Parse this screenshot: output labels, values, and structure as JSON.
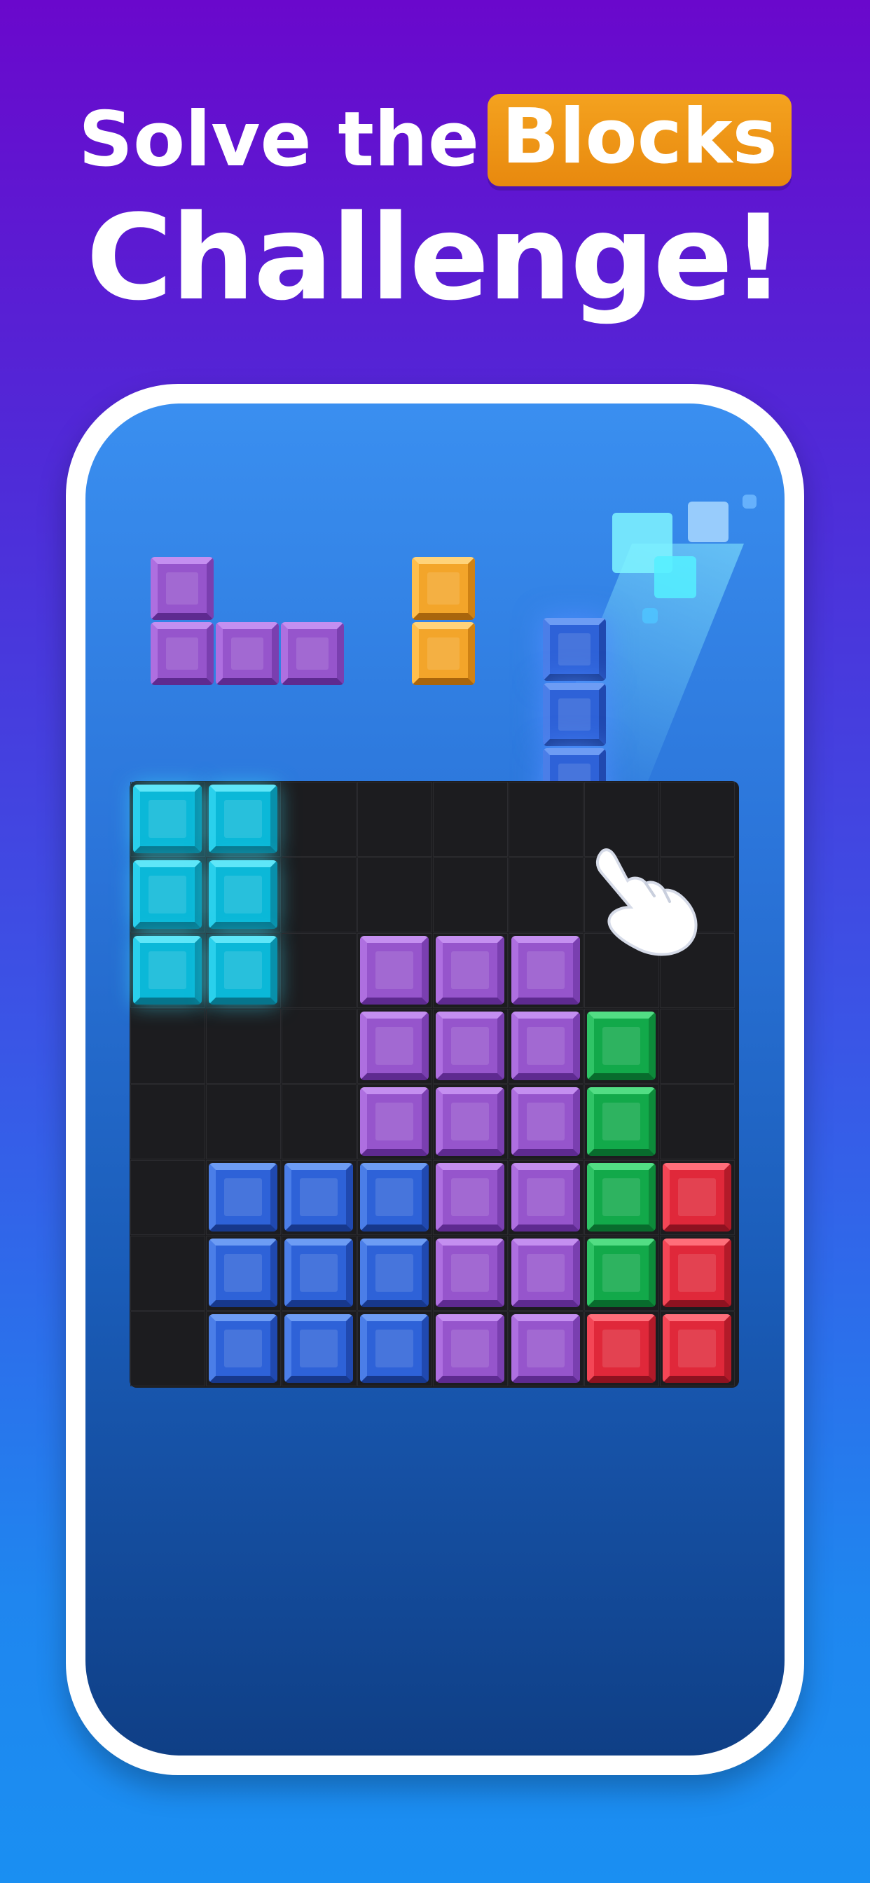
{
  "headline": {
    "line1_prefix": "Solve the",
    "line1_highlight": "Blocks",
    "line2": "Challenge!"
  },
  "colors": {
    "cyan": "#0bb8d8",
    "purple": "#9655cc",
    "blue": "#2e62d8",
    "green": "#12a94a",
    "red": "#e0283a",
    "orange": "#f3a52a",
    "highlight": "#f4a21f"
  },
  "board": {
    "columns": 8,
    "rows": 8,
    "grid": [
      [
        "cyan",
        "cyan",
        "",
        "",
        "",
        "",
        "",
        ""
      ],
      [
        "cyan",
        "cyan",
        "",
        "",
        "",
        "",
        "",
        ""
      ],
      [
        "cyan",
        "cyan",
        "",
        "purple",
        "purple",
        "purple",
        "",
        ""
      ],
      [
        "",
        "",
        "",
        "purple",
        "purple",
        "purple",
        "green",
        ""
      ],
      [
        "",
        "",
        "",
        "purple",
        "purple",
        "purple",
        "green",
        ""
      ],
      [
        "",
        "blue",
        "blue",
        "blue",
        "purple",
        "purple",
        "green",
        "red"
      ],
      [
        "",
        "blue",
        "blue",
        "blue",
        "purple",
        "purple",
        "green",
        "red"
      ],
      [
        "",
        "blue",
        "blue",
        "blue",
        "purple",
        "purple",
        "red",
        "red"
      ]
    ]
  },
  "pieces": [
    {
      "name": "purple-l-piece",
      "color": "purple",
      "shape": [
        [
          1,
          0,
          0
        ],
        [
          1,
          1,
          1
        ]
      ]
    },
    {
      "name": "orange-i2-piece",
      "color": "orange",
      "shape": [
        [
          1
        ],
        [
          1
        ]
      ]
    },
    {
      "name": "blue-i4-piece-dragging",
      "color": "blue",
      "shape": [
        [
          1
        ],
        [
          1
        ],
        [
          1
        ],
        [
          1
        ]
      ]
    }
  ],
  "icons": {
    "pointer": "hand-pointer-icon"
  }
}
